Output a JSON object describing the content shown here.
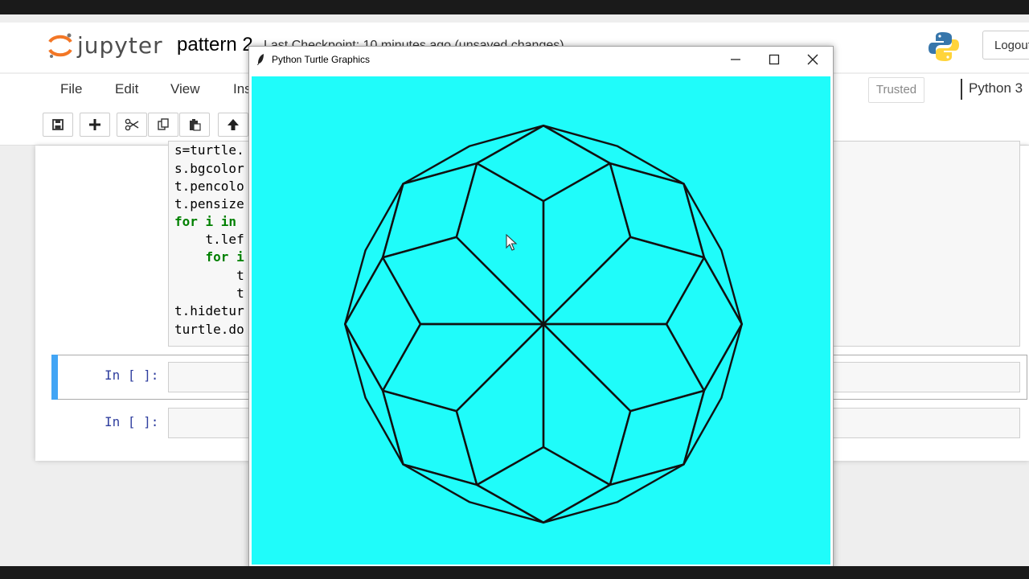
{
  "app": {
    "name": "jupyter",
    "notebook_title": "pattern 2",
    "checkpoint_text": "Last Checkpoint: 10 minutes ago  (unsaved changes)",
    "logout_label": "Logout"
  },
  "menu": {
    "items": [
      "File",
      "Edit",
      "View",
      "Ins"
    ],
    "trusted_label": "Trusted",
    "kernel_name": "Python 3"
  },
  "toolbar": {
    "icons": [
      "save-icon",
      "plus-icon",
      "cut-icon",
      "copy-icon",
      "paste-icon",
      "arrow-up-icon"
    ]
  },
  "code_cell": {
    "lines": [
      "s=turtle.",
      "s.bgcolor",
      "t.pencolo",
      "t.pensize",
      "for i in",
      "    t.lef",
      "    for i",
      "        t",
      "        t",
      "t.hidetur",
      "turtle.do"
    ]
  },
  "empty_cells": [
    {
      "prompt": "In [ ]:"
    },
    {
      "prompt": "In [ ]:"
    }
  ],
  "turtle_window": {
    "title": "Python Turtle Graphics",
    "canvas_color": "#1ffcfa",
    "pen_color": "#111111"
  },
  "colors": {
    "selected_cell_bar": "#42a5f5",
    "prompt": "#303f9f",
    "keyword": "#008000"
  }
}
